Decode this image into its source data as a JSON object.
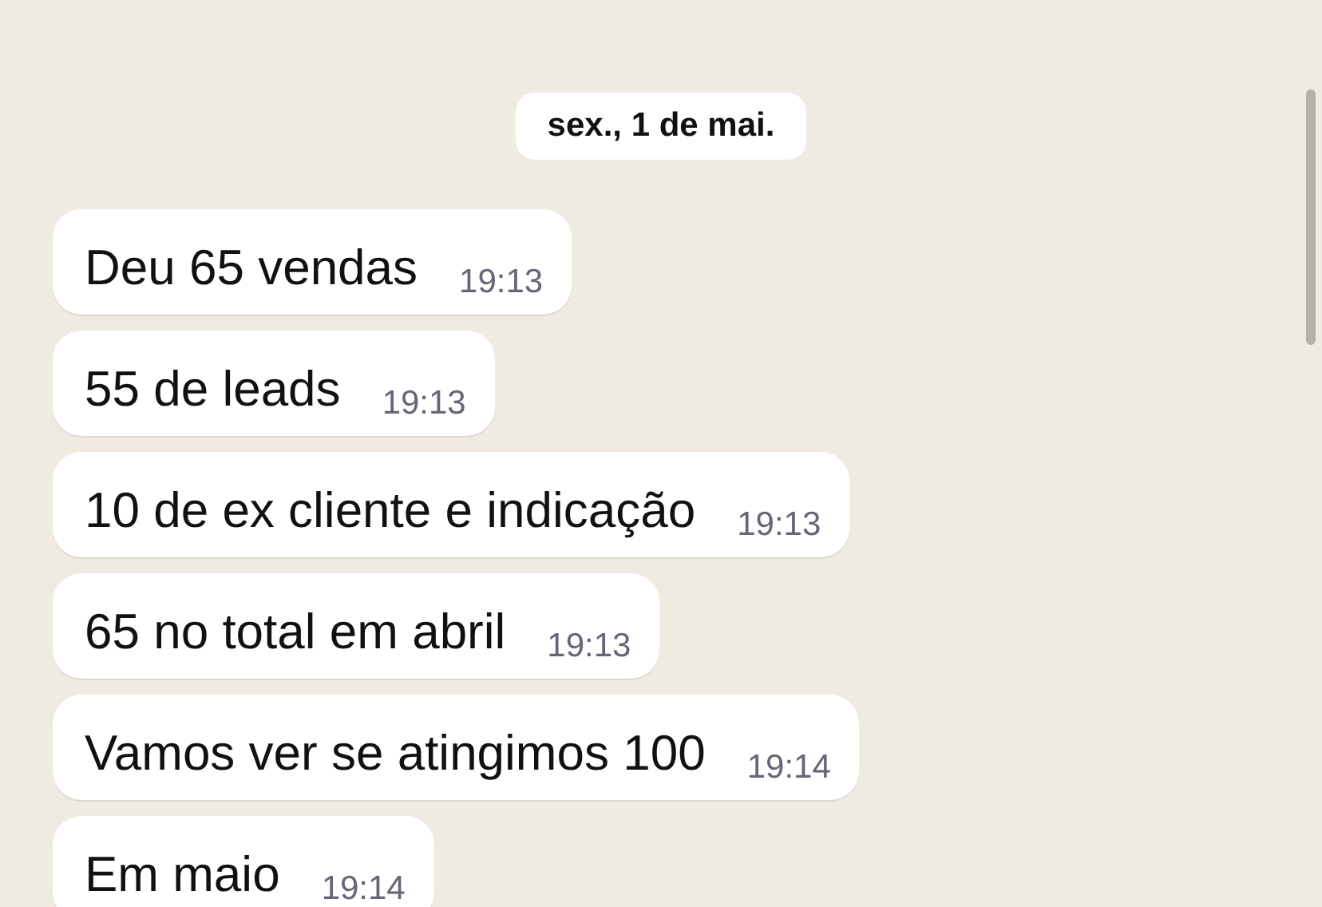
{
  "date_chip": "sex., 1 de mai.",
  "messages": [
    {
      "text": "Deu 65 vendas",
      "time": "19:13"
    },
    {
      "text": "55 de leads",
      "time": "19:13"
    },
    {
      "text": "10 de ex cliente e indicação",
      "time": "19:13"
    },
    {
      "text": "65 no total em abril",
      "time": "19:13"
    },
    {
      "text": "Vamos ver se atingimos 100",
      "time": "19:14"
    },
    {
      "text": "Em maio",
      "time": "19:14"
    }
  ]
}
